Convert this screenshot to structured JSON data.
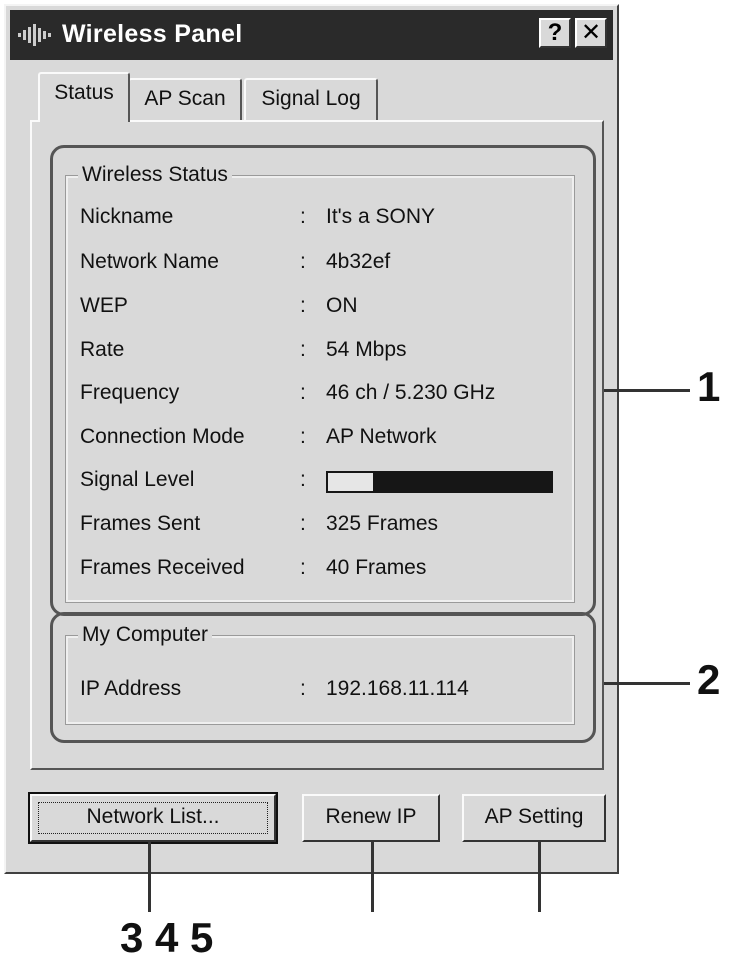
{
  "window": {
    "title": "Wireless Panel",
    "help_label": "?",
    "close_label": "✕"
  },
  "tabs": [
    {
      "label": "Status",
      "active": true
    },
    {
      "label": "AP Scan",
      "active": false
    },
    {
      "label": "Signal Log",
      "active": false
    }
  ],
  "wireless_status": {
    "legend": "Wireless Status",
    "separator": ":",
    "rows": [
      {
        "label": "Nickname",
        "value": "It's a SONY"
      },
      {
        "label": "Network Name",
        "value": "4b32ef"
      },
      {
        "label": "WEP",
        "value": "ON"
      },
      {
        "label": "Rate",
        "value": "54 Mbps"
      },
      {
        "label": "Frequency",
        "value": "46 ch / 5.230 GHz"
      },
      {
        "label": "Connection Mode",
        "value": "AP Network"
      },
      {
        "label": "Signal Level",
        "value": ""
      },
      {
        "label": "Frames Sent",
        "value": "325 Frames"
      },
      {
        "label": "Frames Received",
        "value": "40 Frames"
      }
    ],
    "signal_level_fraction": 0.2
  },
  "my_computer": {
    "legend": "My Computer",
    "rows": [
      {
        "label": "IP Address",
        "value": "192.168.11.114"
      }
    ]
  },
  "buttons": {
    "network_list": "Network List...",
    "renew_ip": "Renew IP",
    "ap_setting": "AP Setting"
  },
  "callouts": {
    "c1": "1",
    "c2": "2",
    "c345": "3 4 5"
  },
  "colors": {
    "window_bg": "#d9d9d9",
    "titlebar": "#2a2a2a",
    "signal_empty": "#161616",
    "signal_fill": "#e6e6e6"
  }
}
